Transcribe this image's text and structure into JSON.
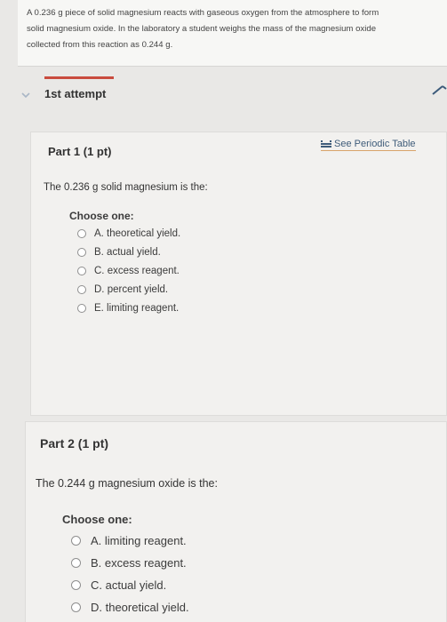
{
  "problem": {
    "line1": "A 0.236 g piece of solid magnesium reacts with gaseous oxygen from the atmosphere to form",
    "line2": "solid magnesium oxide. In the laboratory a student weighs the mass of the magnesium oxide",
    "line3": "collected from this reaction as 0.244 g."
  },
  "attempt": {
    "label": "1st attempt"
  },
  "periodic_link": {
    "label": "See Periodic Table"
  },
  "part1": {
    "title": "Part 1 (1 pt)",
    "question": "The 0.236 g solid magnesium is the:",
    "choose_label": "Choose one:",
    "choices": [
      "A. theoretical yield.",
      "B. actual yield.",
      "C. excess reagent.",
      "D. percent yield.",
      "E. limiting reagent."
    ]
  },
  "part2": {
    "title": "Part 2 (1 pt)",
    "question": "The 0.244 g magnesium oxide is the:",
    "choose_label": "Choose one:",
    "choices": [
      "A. limiting reagent.",
      "B. excess reagent.",
      "C. actual yield.",
      "D. theoretical yield."
    ]
  },
  "colors": {
    "accent_tab": "#c94b3e",
    "link": "#3e5c7a",
    "link_underline": "#d9a46a"
  },
  "icons": {
    "chevron": "chevron-down-icon",
    "periodic": "periodic-table-icon",
    "pencil": "pencil-icon"
  }
}
